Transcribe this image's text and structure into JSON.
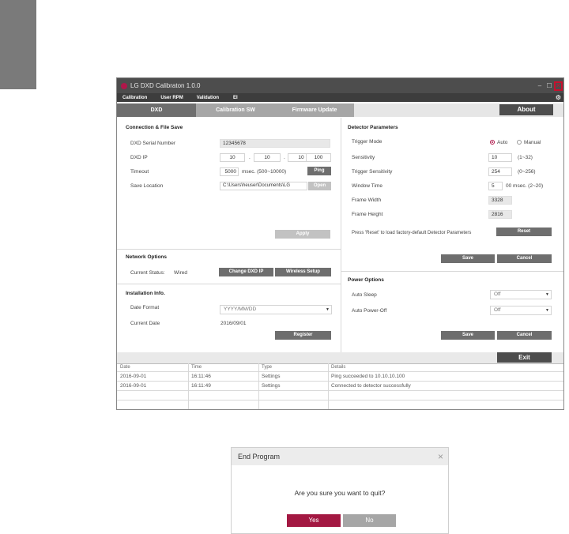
{
  "app": {
    "title": "LG DXD Calibraton 1.0.0"
  },
  "menu": [
    "Calibration",
    "User RPM",
    "Validation",
    "EI"
  ],
  "tabs": [
    "DXD",
    "Calibration SW",
    "Firmware Update"
  ],
  "about": "About",
  "conn": {
    "title": "Connection & File Save",
    "serial_label": "DXD Serial Number",
    "serial": "12345678",
    "ip_label": "DXD IP",
    "ip": [
      "10",
      "10",
      "10",
      "100"
    ],
    "dot": ".",
    "timeout_label": "Timeout",
    "timeout": "5000",
    "timeout_unit": "msec. (500~10000)",
    "ping": "Ping",
    "save_label": "Save Location",
    "save_path": "C:\\Users\\heuser\\Documents\\LG",
    "open": "Open",
    "apply": "Apply"
  },
  "network": {
    "title": "Network Options",
    "status_label": "Current Status:",
    "status": "Wired",
    "change_ip": "Change DXD IP",
    "wireless": "Wireless Setup"
  },
  "install": {
    "title": "Installation Info.",
    "date_format_label": "Date Format",
    "date_format_placeholder": "YYYY/MM/DD",
    "current_date_label": "Current Date",
    "current_date": "2016/09/01",
    "register": "Register"
  },
  "detector": {
    "title": "Detector Parameters",
    "trigger_mode_label": "Trigger Mode",
    "auto": "Auto",
    "manual": "Manual",
    "sensitivity_label": "Sensitivity",
    "sensitivity": "10",
    "sensitivity_range": "(1~32)",
    "trig_sens_label": "Trigger Sensitivity",
    "trig_sens": "254",
    "trig_sens_range": "(0~256)",
    "window_label": "Window Time",
    "window": "5",
    "window_unit": "00 msec. (2~20)",
    "fw_label": "Frame Width",
    "fw": "3328",
    "fh_label": "Frame Height",
    "fh": "2816",
    "reset_note": "Press 'Reset' to load factory-default Detector Parameters",
    "reset": "Reset",
    "save": "Save",
    "cancel": "Cancel"
  },
  "power": {
    "title": "Power Options",
    "sleep_label": "Auto Sleep",
    "sleep": "Off",
    "off_label": "Auto Power-Off",
    "off": "Off",
    "save": "Save",
    "cancel": "Cancel"
  },
  "exit": "Exit",
  "log": {
    "headers": [
      "Date",
      "Time",
      "Type",
      "Details"
    ],
    "rows": [
      [
        "2016-09-01",
        "16:11:46",
        "Settings",
        "Ping succeeded to  10.10.10.100"
      ],
      [
        "2016-09-01",
        "16:11:49",
        "Settings",
        "Connected to detector successfully"
      ]
    ]
  },
  "dialog": {
    "title": "End Program",
    "message": "Are you sure you want to quit?",
    "yes": "Yes",
    "no": "No"
  }
}
